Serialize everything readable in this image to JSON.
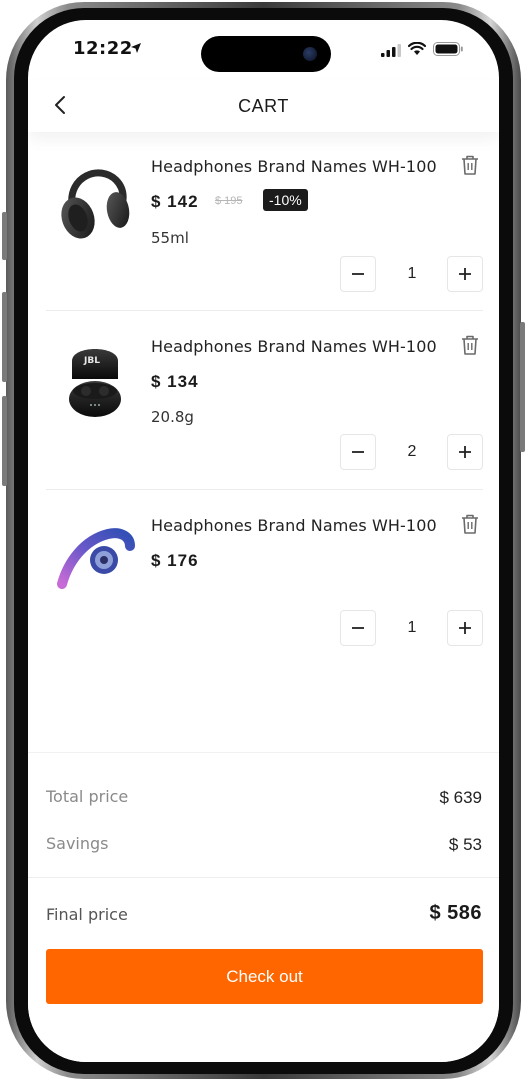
{
  "status_bar": {
    "time": "12:22"
  },
  "header": {
    "title": "CART"
  },
  "items": [
    {
      "name": "Headphones Brand Names WH-100",
      "price": "$ 142",
      "old_price": "$ 195",
      "discount": "-10%",
      "variant": "55ml",
      "quantity": "1",
      "image": "over-ear-headphones-icon"
    },
    {
      "name": "Headphones Brand Names WH-100",
      "price": "$ 134",
      "variant": "20.8g",
      "quantity": "2",
      "image": "earbuds-case-icon"
    },
    {
      "name": "Headphones Brand Names WH-100",
      "price": "$ 176",
      "quantity": "1",
      "image": "ear-hook-headphone-icon"
    }
  ],
  "summary": {
    "total_label": "Total price",
    "total_value": "$ 639",
    "savings_label": "Savings",
    "savings_value": "$ 53",
    "final_label": "Final price",
    "final_value": "$ 586",
    "checkout_label": "Check out"
  },
  "colors": {
    "accent": "#ff6600",
    "badge_bg": "#1c1c1c"
  }
}
